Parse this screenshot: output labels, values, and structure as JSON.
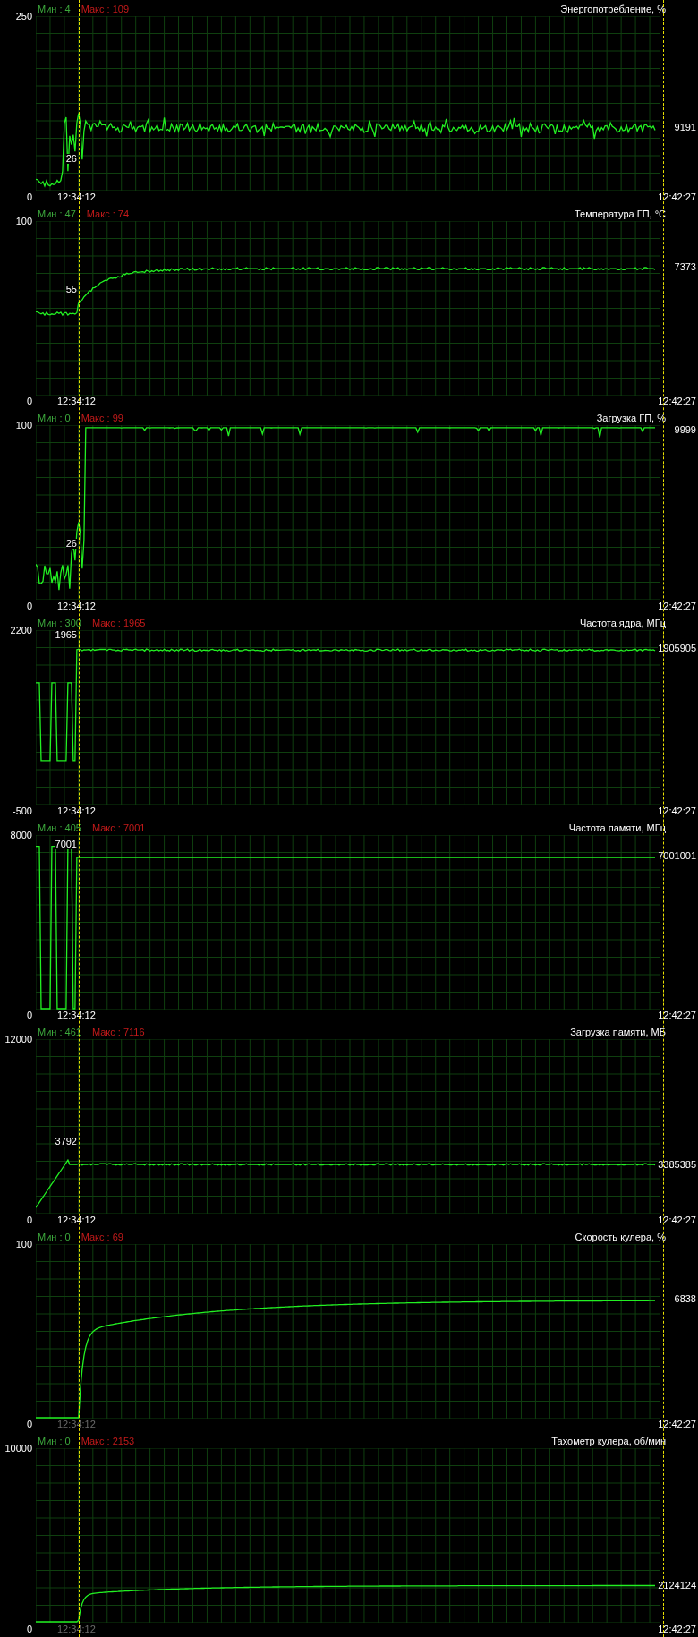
{
  "panels": [
    {
      "kind": "noisy-plateau",
      "min": "Мин : 4",
      "max": "Макс : 109",
      "title": "Энергопотребление, %",
      "y_max": "250",
      "y_min": "0",
      "start_time": "12:34:12",
      "start_time_dimmed": false,
      "end_time": "12:42:27",
      "start_value": "26",
      "current_value": "9191"
    },
    {
      "kind": "warmup",
      "min": "Мин : 47",
      "max": "Макс : 74",
      "title": "Температура ГП, °C",
      "y_max": "100",
      "y_min": "0",
      "start_time": "12:34:12",
      "start_time_dimmed": false,
      "end_time": "12:42:27",
      "start_value": "55",
      "current_value": "7373"
    },
    {
      "kind": "full-load",
      "min": "Мин : 0",
      "max": "Макс : 99",
      "title": "Загрузка ГП, %",
      "y_max": "100",
      "y_min": "0",
      "start_time": "12:34:12",
      "start_time_dimmed": false,
      "end_time": "12:42:27",
      "start_value": "26",
      "current_value": "9999"
    },
    {
      "kind": "core-clock",
      "min": "Мин : 300",
      "max": "Макс : 1965",
      "title": "Частота ядра, МГц",
      "y_max": "2200",
      "y_min": "-500",
      "start_time": "12:34:12",
      "start_time_dimmed": false,
      "end_time": "12:42:27",
      "start_value": "1965",
      "current_value": "1905905"
    },
    {
      "kind": "memory-clock",
      "min": "Мин : 405",
      "max": "Макс : 7001",
      "title": "Частота памяти, МГц",
      "y_max": "8000",
      "y_min": "0",
      "start_time": "12:34:12",
      "start_time_dimmed": false,
      "end_time": "12:42:27",
      "start_value": "7001",
      "current_value": "7001001"
    },
    {
      "kind": "ramp",
      "min": "Мин : 461",
      "max": "Макс : 7116",
      "title": "Загрузка памяти, МБ",
      "y_max": "12000",
      "y_min": "0",
      "start_time": "12:34:12",
      "start_time_dimmed": false,
      "end_time": "12:42:27",
      "start_value": "3792",
      "current_value": "3385385"
    },
    {
      "kind": "fan-curve",
      "min": "Мин : 0",
      "max": "Макс : 69",
      "title": "Скорость кулера, %",
      "y_max": "100",
      "y_min": "0",
      "start_time": "12:34:12",
      "start_time_dimmed": true,
      "end_time": "12:42:27",
      "current_value": "6838"
    },
    {
      "kind": "rpm-curve",
      "min": "Мин : 0",
      "max": "Макс : 2153",
      "title": "Тахометр кулера, об/мин",
      "y_max": "10000",
      "y_min": "0",
      "start_time": "12:34:12",
      "start_time_dimmed": true,
      "end_time": "12:42:27",
      "current_value": "2124124"
    }
  ]
}
